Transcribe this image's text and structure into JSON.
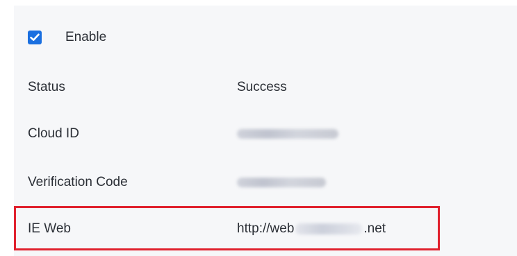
{
  "settings": {
    "enable": {
      "label": "Enable",
      "checked": true
    },
    "rows": {
      "status": {
        "label": "Status",
        "value": "Success"
      },
      "cloud_id": {
        "label": "Cloud ID"
      },
      "verification_code": {
        "label": "Verification Code"
      },
      "ie_web": {
        "label": "IE Web",
        "url_prefix": "http://web",
        "url_suffix": ".net"
      }
    }
  },
  "colors": {
    "checkbox": "#1a6fe0",
    "highlight": "#e0212e",
    "panel_background": "#f6f7f9"
  },
  "icons": {
    "checkbox": "check-icon"
  }
}
